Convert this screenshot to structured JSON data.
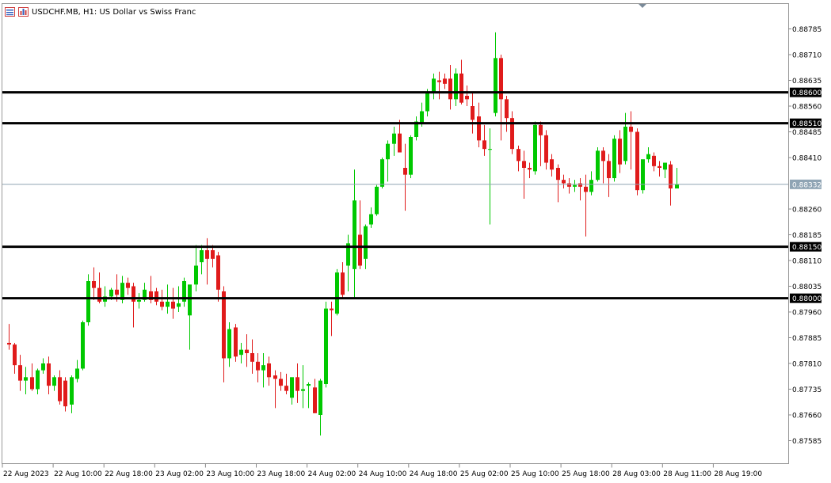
{
  "header": {
    "title": "USDCHF.MB, H1:  US Dollar vs Swiss Franc",
    "icons": [
      "chart-list-icon",
      "chart-bars-icon"
    ]
  },
  "colors": {
    "bull": "#00c800",
    "bear": "#e01b1b",
    "level_line": "#000000",
    "current_price_line": "#8fa4b4",
    "current_price_badge": "#8fa4b4",
    "level_badge": "#000000"
  },
  "chart_data": {
    "type": "candlestick",
    "symbol": "USDCHF.MB",
    "timeframe": "H1",
    "ylim": [
      0.8754,
      0.8883
    ],
    "y_ticks": [
      "0.88785",
      "0.88710",
      "0.88635",
      "0.88560",
      "0.88485",
      "0.88410",
      "0.88260",
      "0.88185",
      "0.88110",
      "0.88035",
      "0.87960",
      "0.87885",
      "0.87810",
      "0.87735",
      "0.87660",
      "0.87585"
    ],
    "x_labels": [
      "22 Aug 2023",
      "22 Aug 10:00",
      "22 Aug 18:00",
      "23 Aug 02:00",
      "23 Aug 10:00",
      "23 Aug 18:00",
      "24 Aug 02:00",
      "24 Aug 10:00",
      "24 Aug 18:00",
      "25 Aug 02:00",
      "25 Aug 10:00",
      "25 Aug 18:00",
      "28 Aug 03:00",
      "28 Aug 11:00",
      "28 Aug 19:00"
    ],
    "levels": [
      {
        "label": "0.88600",
        "value": 0.886
      },
      {
        "label": "0.88510",
        "value": 0.8851
      },
      {
        "label": "0.88150",
        "value": 0.8815
      },
      {
        "label": "0.88000",
        "value": 0.88
      }
    ],
    "current_price": {
      "label": "0.88332",
      "value": 0.88332
    },
    "candles": [
      [
        0.8787,
        0.87925,
        0.8785,
        0.87865
      ],
      [
        0.87865,
        0.8787,
        0.8778,
        0.87805
      ],
      [
        0.87805,
        0.87835,
        0.8773,
        0.8776
      ],
      [
        0.8776,
        0.878,
        0.8772,
        0.8777
      ],
      [
        0.8777,
        0.8781,
        0.8773,
        0.87735
      ],
      [
        0.87735,
        0.87795,
        0.8772,
        0.8779
      ],
      [
        0.8779,
        0.87825,
        0.8778,
        0.8781
      ],
      [
        0.8781,
        0.8783,
        0.8772,
        0.87745
      ],
      [
        0.87745,
        0.87775,
        0.8773,
        0.8777
      ],
      [
        0.8777,
        0.8779,
        0.8769,
        0.877
      ],
      [
        0.8776,
        0.8777,
        0.8767,
        0.87685
      ],
      [
        0.8769,
        0.87775,
        0.87665,
        0.8777
      ],
      [
        0.87765,
        0.8782,
        0.87755,
        0.87795
      ],
      [
        0.87795,
        0.87935,
        0.8779,
        0.8793
      ],
      [
        0.8793,
        0.8807,
        0.8792,
        0.8805
      ],
      [
        0.8805,
        0.8809,
        0.87995,
        0.8803
      ],
      [
        0.8803,
        0.88075,
        0.87985,
        0.8799
      ],
      [
        0.8799,
        0.88035,
        0.87975,
        0.88005
      ],
      [
        0.88005,
        0.8803,
        0.87995,
        0.88025
      ],
      [
        0.88025,
        0.8807,
        0.8799,
        0.8801
      ],
      [
        0.87995,
        0.88065,
        0.87985,
        0.88045
      ],
      [
        0.88045,
        0.8806,
        0.8801,
        0.8803
      ],
      [
        0.88035,
        0.88045,
        0.87915,
        0.8799
      ],
      [
        0.8799,
        0.88015,
        0.8797,
        0.87995
      ],
      [
        0.87995,
        0.88045,
        0.8799,
        0.88025
      ],
      [
        0.8802,
        0.88065,
        0.87985,
        0.87995
      ],
      [
        0.8802,
        0.8803,
        0.8798,
        0.8799
      ],
      [
        0.8799,
        0.88025,
        0.87965,
        0.87975
      ],
      [
        0.87975,
        0.8804,
        0.87955,
        0.8799
      ],
      [
        0.8799,
        0.8803,
        0.8794,
        0.8797
      ],
      [
        0.87975,
        0.88035,
        0.8796,
        0.87985
      ],
      [
        0.8799,
        0.8806,
        0.87975,
        0.8805
      ],
      [
        0.8795,
        0.88035,
        0.8785,
        0.8804
      ],
      [
        0.8804,
        0.88155,
        0.8802,
        0.88095
      ],
      [
        0.88105,
        0.88155,
        0.8807,
        0.8814
      ],
      [
        0.8814,
        0.88175,
        0.8804,
        0.88115
      ],
      [
        0.8814,
        0.88155,
        0.8809,
        0.88115
      ],
      [
        0.88125,
        0.88135,
        0.8799,
        0.88025
      ],
      [
        0.8802,
        0.88035,
        0.87755,
        0.87825
      ],
      [
        0.87825,
        0.8793,
        0.878,
        0.8791
      ],
      [
        0.87915,
        0.87925,
        0.87815,
        0.8783
      ],
      [
        0.87835,
        0.8787,
        0.8781,
        0.8785
      ],
      [
        0.8785,
        0.87895,
        0.878,
        0.8784
      ],
      [
        0.8784,
        0.8788,
        0.8778,
        0.87815
      ],
      [
        0.87815,
        0.8784,
        0.87755,
        0.8779
      ],
      [
        0.8779,
        0.8784,
        0.8774,
        0.87805
      ],
      [
        0.8781,
        0.8783,
        0.87745,
        0.8777
      ],
      [
        0.87775,
        0.8779,
        0.8768,
        0.87765
      ],
      [
        0.87765,
        0.87785,
        0.8773,
        0.87745
      ],
      [
        0.87745,
        0.8778,
        0.8772,
        0.8773
      ],
      [
        0.8771,
        0.8777,
        0.8769,
        0.8777
      ],
      [
        0.8777,
        0.8781,
        0.87695,
        0.8773
      ],
      [
        0.8773,
        0.87805,
        0.8768,
        0.87735
      ],
      [
        0.87745,
        0.87755,
        0.8768,
        0.8775
      ],
      [
        0.8774,
        0.87765,
        0.87665,
        0.87665
      ],
      [
        0.8766,
        0.87765,
        0.876,
        0.8776
      ],
      [
        0.8775,
        0.8799,
        0.8774,
        0.8797
      ],
      [
        0.8797,
        0.8799,
        0.8789,
        0.87965
      ],
      [
        0.87955,
        0.88085,
        0.8795,
        0.88075
      ],
      [
        0.88075,
        0.88105,
        0.88,
        0.8801
      ],
      [
        0.88095,
        0.88185,
        0.8802,
        0.8816
      ],
      [
        0.88085,
        0.88375,
        0.88,
        0.88285
      ],
      [
        0.88185,
        0.88285,
        0.88085,
        0.88095
      ],
      [
        0.88115,
        0.88215,
        0.88085,
        0.8821
      ],
      [
        0.88215,
        0.88265,
        0.88205,
        0.88245
      ],
      [
        0.88245,
        0.8833,
        0.8824,
        0.88325
      ],
      [
        0.88325,
        0.8841,
        0.8832,
        0.88405
      ],
      [
        0.88405,
        0.8846,
        0.8834,
        0.8845
      ],
      [
        0.8845,
        0.885,
        0.88415,
        0.8848
      ],
      [
        0.8848,
        0.8852,
        0.8845,
        0.88425
      ],
      [
        0.8838,
        0.8845,
        0.88255,
        0.8836
      ],
      [
        0.8836,
        0.88475,
        0.8835,
        0.8847
      ],
      [
        0.8847,
        0.8853,
        0.8846,
        0.88515
      ],
      [
        0.8851,
        0.8857,
        0.885,
        0.88545
      ],
      [
        0.88545,
        0.8861,
        0.8853,
        0.886
      ],
      [
        0.886,
        0.88655,
        0.8858,
        0.8864
      ],
      [
        0.88635,
        0.8866,
        0.8858,
        0.8863
      ],
      [
        0.8864,
        0.88655,
        0.8861,
        0.88625
      ],
      [
        0.8864,
        0.8868,
        0.8855,
        0.8858
      ],
      [
        0.8858,
        0.8867,
        0.8856,
        0.88655
      ],
      [
        0.88655,
        0.88695,
        0.88565,
        0.8857
      ],
      [
        0.8859,
        0.8862,
        0.8856,
        0.8858
      ],
      [
        0.8856,
        0.886,
        0.8848,
        0.8852
      ],
      [
        0.8853,
        0.8857,
        0.8844,
        0.8846
      ],
      [
        0.8846,
        0.88505,
        0.88415,
        0.88435
      ],
      [
        0.88435,
        0.88495,
        0.88215,
        0.88435
      ],
      [
        0.8854,
        0.88775,
        0.8853,
        0.887
      ],
      [
        0.887,
        0.8871,
        0.8846,
        0.8858
      ],
      [
        0.8858,
        0.8859,
        0.88485,
        0.88525
      ],
      [
        0.88525,
        0.88545,
        0.8842,
        0.88435
      ],
      [
        0.88435,
        0.88445,
        0.8837,
        0.884
      ],
      [
        0.884,
        0.8843,
        0.8829,
        0.8838
      ],
      [
        0.8838,
        0.88395,
        0.8835,
        0.88375
      ],
      [
        0.8837,
        0.88515,
        0.8836,
        0.88505
      ],
      [
        0.88505,
        0.88515,
        0.88385,
        0.88475
      ],
      [
        0.88475,
        0.8849,
        0.88375,
        0.88395
      ],
      [
        0.88405,
        0.8842,
        0.88355,
        0.88375
      ],
      [
        0.8838,
        0.8839,
        0.8828,
        0.88345
      ],
      [
        0.88345,
        0.8836,
        0.8832,
        0.88335
      ],
      [
        0.88335,
        0.8835,
        0.88305,
        0.88325
      ],
      [
        0.88325,
        0.88345,
        0.8831,
        0.8833
      ],
      [
        0.88335,
        0.8835,
        0.88285,
        0.88325
      ],
      [
        0.88325,
        0.8836,
        0.8818,
        0.8831
      ],
      [
        0.8831,
        0.8837,
        0.883,
        0.88345
      ],
      [
        0.88345,
        0.8844,
        0.8834,
        0.8843
      ],
      [
        0.8843,
        0.8844,
        0.88335,
        0.884
      ],
      [
        0.884,
        0.8842,
        0.88295,
        0.8835
      ],
      [
        0.8835,
        0.88475,
        0.8834,
        0.88465
      ],
      [
        0.88465,
        0.8849,
        0.88365,
        0.8839
      ],
      [
        0.884,
        0.8854,
        0.8839,
        0.885
      ],
      [
        0.885,
        0.88545,
        0.88375,
        0.88485
      ],
      [
        0.88485,
        0.88495,
        0.883,
        0.88315
      ],
      [
        0.88315,
        0.884,
        0.88305,
        0.88405
      ],
      [
        0.88405,
        0.8844,
        0.88395,
        0.8842
      ],
      [
        0.88415,
        0.88425,
        0.8837,
        0.88385
      ],
      [
        0.88385,
        0.884,
        0.88355,
        0.8838
      ],
      [
        0.88375,
        0.88395,
        0.8835,
        0.88395
      ],
      [
        0.8839,
        0.884,
        0.8827,
        0.8832
      ],
      [
        0.8832,
        0.8838,
        0.8832,
        0.88332
      ]
    ]
  }
}
